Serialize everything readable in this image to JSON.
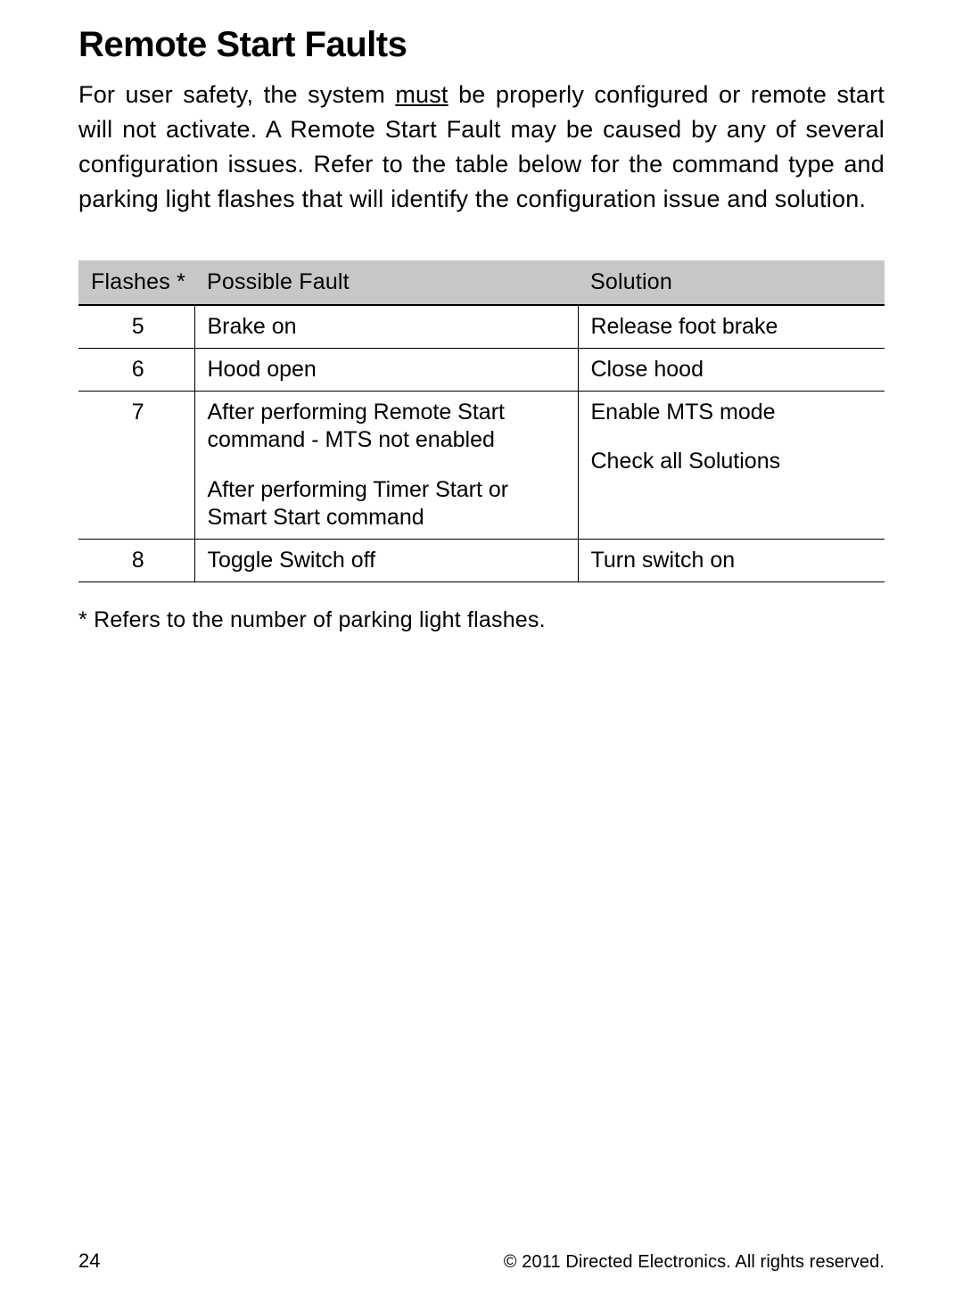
{
  "heading": "Remote Start Faults",
  "intro_pre": "For user safety, the system ",
  "intro_must": "must",
  "intro_post": " be properly configured or remote start will not activate. A Remote Start Fault may be caused by any of several configuration issues. Refer to the table below for the command type and parking light flashes that will identify the configuration issue and solution.",
  "table": {
    "headers": {
      "flashes": "Flashes *",
      "fault": "Possible Fault",
      "solution": "Solution"
    },
    "rows": [
      {
        "flashes": "5",
        "fault": "Brake on",
        "solution": "Release foot brake"
      },
      {
        "flashes": "6",
        "fault": "Hood open",
        "solution": "Close hood"
      },
      {
        "flashes": "7",
        "fault_a": "After performing Remote Start command - MTS not enabled",
        "solution_a": "Enable MTS mode",
        "fault_b": "After performing Timer Start or Smart Start command",
        "solution_b": "Check all Solutions"
      },
      {
        "flashes": "8",
        "fault": "Toggle Switch off",
        "solution": "Turn switch on"
      }
    ]
  },
  "footnote": "* Refers to the number of parking light flashes.",
  "page_number": "24",
  "copyright": "© 2011 Directed Electronics. All rights reserved."
}
